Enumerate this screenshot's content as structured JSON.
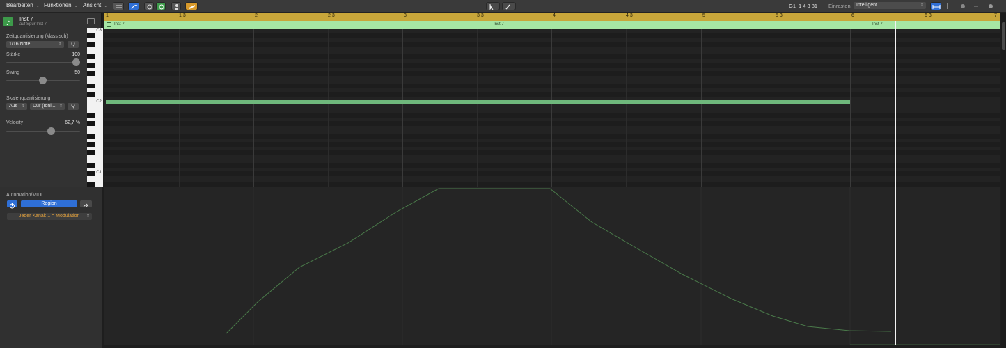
{
  "menubar": {
    "edit": "Bearbeiten",
    "functions": "Funktionen",
    "view": "Ansicht",
    "position": "G1",
    "position_value": "1 4 3 81",
    "snap_label": "Einrasten:",
    "snap_value": "Intelligent"
  },
  "inspector": {
    "region_name": "Inst 7",
    "region_sub": "auf Spur Inst 7",
    "time_quant_label": "Zeitquantisierung (klassisch)",
    "time_quant_value": "1/16 Note",
    "q_label": "Q",
    "strength_label": "Stärke",
    "strength_value": "100",
    "swing_label": "Swing",
    "swing_value": "50",
    "scale_quant_label": "Skalenquantisierung",
    "scale_off": "Aus",
    "scale_mode": "Dur (Ioni...",
    "scale_q": "Q",
    "velocity_label": "Velocity",
    "velocity_value": "62,7 %",
    "strength_level": 1.0,
    "swing_level": 0.5,
    "velocity_level": 0.627
  },
  "automation": {
    "title": "Automation/MIDI",
    "region_button": "Region",
    "channel_value": "Jeder Kanal: 1 = Modulation"
  },
  "piano": {
    "c3": "C3",
    "c2": "C2",
    "c1": "C1"
  },
  "ruler": {
    "bars": [
      "1",
      "1 3",
      "2",
      "2 3",
      "3",
      "3 3",
      "4",
      "4 3",
      "5",
      "5 3",
      "6",
      "6 3",
      "7"
    ]
  },
  "region": {
    "labels": [
      "Inst 7",
      "Inst 7",
      "Inst 7"
    ]
  }
}
